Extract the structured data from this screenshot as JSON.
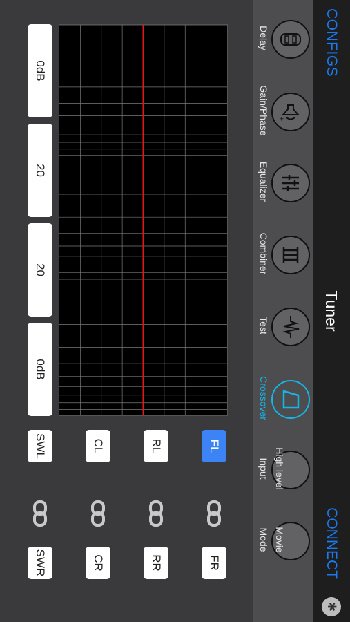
{
  "header": {
    "configs_label": "CONFIGS",
    "title": "Tuner",
    "connect_label": "CONNECT",
    "bluetooth_icon": "bluetooth-icon"
  },
  "toolbar": {
    "delay": "Delay",
    "gain_phase": "Gain/Phase",
    "equalizer": "Equalizer",
    "combiner": "Combiner",
    "test": "Test",
    "crossover": "Crossover",
    "high_level_input_1": "High level",
    "high_level_input_2": "Input",
    "movie_mode_1": "Movie",
    "movie_mode_2": "Mode",
    "active_item": "Crossover",
    "active_color": "#14b6e8"
  },
  "graph": {
    "cursor_color": "#e01818"
  },
  "values": {
    "v1": "0dB",
    "v2": "20",
    "v3": "20",
    "v4": "0dB"
  },
  "channels": {
    "fl": "FL",
    "fr": "FR",
    "rl": "RL",
    "rr": "RR",
    "cl": "CL",
    "cr": "CR",
    "swl": "SWL",
    "swr": "SWR",
    "selected": "FL",
    "selected_color": "#3c83f5"
  }
}
